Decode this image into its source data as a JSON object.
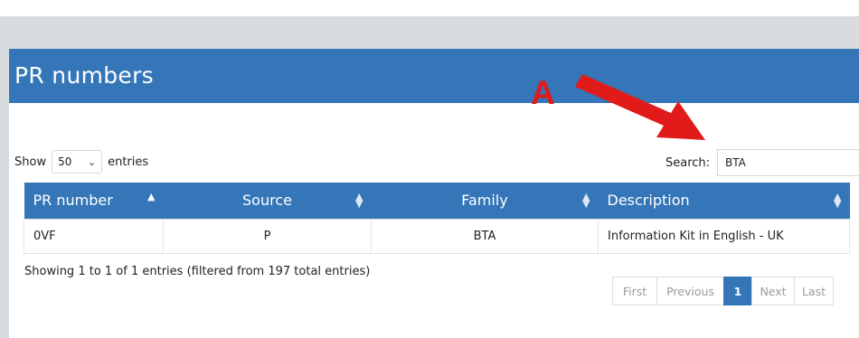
{
  "panel": {
    "title": "PR numbers"
  },
  "annotation": {
    "letter": "A",
    "color": "#e11a1a"
  },
  "length": {
    "show_label": "Show",
    "selected": "50",
    "entries_label": "entries"
  },
  "search": {
    "label": "Search:",
    "value": "BTA"
  },
  "table": {
    "headers": [
      "PR number",
      "Source",
      "Family",
      "Description"
    ],
    "rows": [
      [
        "0VF",
        "P",
        "BTA",
        "Information Kit in English - UK"
      ]
    ]
  },
  "info": "Showing 1 to 1 of 1 entries (filtered from 197 total entries)",
  "pagination": {
    "first": "First",
    "previous": "Previous",
    "current": "1",
    "next": "Next",
    "last": "Last"
  },
  "colors": {
    "accent": "#3476b8",
    "annotation": "#e11a1a"
  }
}
